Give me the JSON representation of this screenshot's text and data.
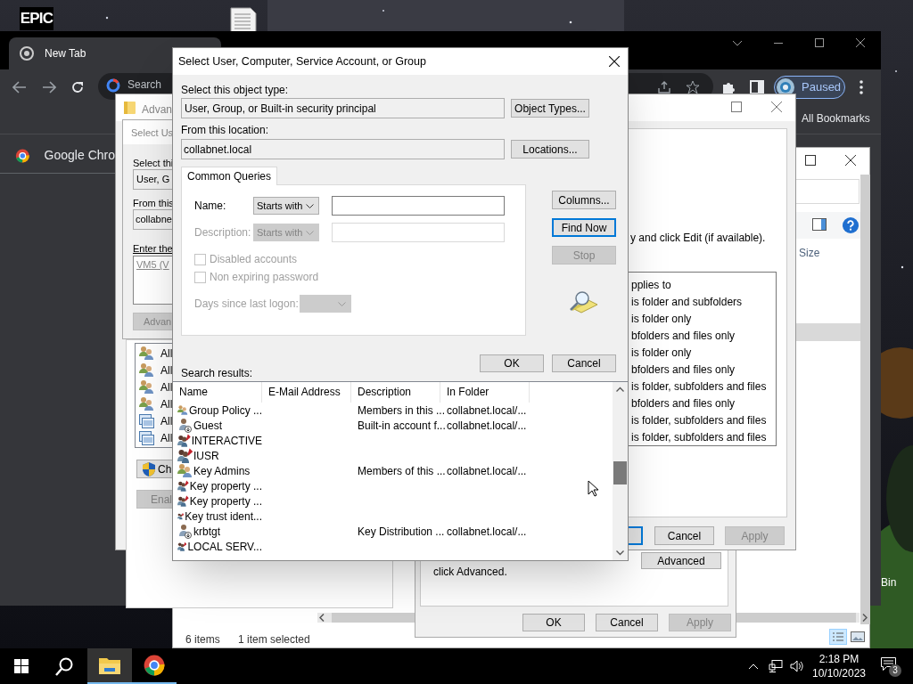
{
  "desktop": {
    "logo": "EPIC",
    "recycle_bin_label": "Bin"
  },
  "browser": {
    "tab_title": "New Tab",
    "omnibox_placeholder": "Search",
    "profile": "Paused",
    "bookmarks": "All Bookmarks",
    "suggestion": "Google Chro"
  },
  "explorer": {
    "column": "Size",
    "item_count": "6 items",
    "selection": "1 item selected"
  },
  "advanced_window": {
    "title": "Advan",
    "instruction": "y and click Edit (if available).",
    "applies_header": "pplies to",
    "applies_rows": [
      "is folder and subfolders",
      "is folder only",
      "bfolders and files only",
      "is folder only",
      "bfolders and files only",
      "is folder, subfolders and files",
      "bfolders and files only",
      "is folder, subfolders and files",
      "is folder, subfolders and files"
    ],
    "principals": [
      {
        "label": "All",
        "kind": "group"
      },
      {
        "label": "All",
        "kind": "group"
      },
      {
        "label": "All",
        "kind": "group"
      },
      {
        "label": "All",
        "kind": "group"
      },
      {
        "label": "All",
        "kind": "package"
      },
      {
        "label": "All",
        "kind": "package"
      }
    ],
    "left_buttons": [
      {
        "label": "Ch",
        "kind": "shield",
        "disabled": false
      },
      {
        "label": "Enal",
        "kind": "plain",
        "disabled": true
      }
    ],
    "footer_buttons": [
      {
        "label": "Cancel",
        "disabled": false
      },
      {
        "label": "Apply",
        "disabled": true
      }
    ]
  },
  "inner_dialog": {
    "title": "Select Us",
    "object_type_label": "Select thi",
    "object_type": "User, G",
    "location_label": "From this",
    "location": "collabne",
    "names_label": "Enter the",
    "names_value": "VM5 (V",
    "advanced_button": "Advan"
  },
  "properties_dialog": {
    "note": "click Advanced.",
    "advanced_button": "Advanced",
    "buttons": [
      {
        "label": "OK",
        "disabled": false
      },
      {
        "label": "Cancel",
        "disabled": false
      },
      {
        "label": "Apply",
        "disabled": true
      }
    ]
  },
  "main_dialog": {
    "title": "Select User, Computer, Service Account, or Group",
    "object_type_label": "Select this object type:",
    "object_type": "User, Group, or Built-in security principal",
    "object_types_button": "Object Types...",
    "location_label": "From this location:",
    "location": "collabnet.local",
    "locations_button": "Locations...",
    "tabs": [
      {
        "label": "Common Queries",
        "selected": true
      }
    ],
    "queries": [
      {
        "label": "Name:",
        "operator": "Starts with",
        "disabled": false
      },
      {
        "label": "Description:",
        "operator": "Starts with",
        "disabled": true
      }
    ],
    "checkboxes": [
      {
        "label": "Disabled accounts",
        "checked": false,
        "disabled": true
      },
      {
        "label": "Non expiring password",
        "checked": false,
        "disabled": true
      }
    ],
    "days_label": "Days since last logon:",
    "side_buttons": [
      {
        "label": "Columns...",
        "default": false,
        "disabled": false
      },
      {
        "label": "Find Now",
        "default": true,
        "disabled": false
      },
      {
        "label": "Stop",
        "default": false,
        "disabled": true
      }
    ],
    "ok": "OK",
    "cancel": "Cancel",
    "results_label": "Search results:",
    "columns": [
      "Name",
      "E-Mail Address",
      "Description",
      "In Folder"
    ],
    "results": [
      {
        "kind": "group",
        "name": "Group Policy ...",
        "description": "Members in this ...",
        "folder": "collabnet.local/..."
      },
      {
        "kind": "user",
        "name": "Guest",
        "description": "Built-in account f...",
        "folder": "collabnet.local/..."
      },
      {
        "kind": "principal",
        "name": "INTERACTIVE"
      },
      {
        "kind": "principal",
        "name": "IUSR"
      },
      {
        "kind": "group",
        "name": "Key Admins",
        "description": "Members of this ...",
        "folder": "collabnet.local/..."
      },
      {
        "kind": "principal",
        "name": "Key property ..."
      },
      {
        "kind": "principal",
        "name": "Key property ..."
      },
      {
        "kind": "principal",
        "name": "Key trust ident..."
      },
      {
        "kind": "user",
        "name": "krbtgt",
        "description": "Key Distribution ...",
        "folder": "collabnet.local/..."
      },
      {
        "kind": "principal",
        "name": "LOCAL SERV..."
      }
    ]
  },
  "taskbar": {
    "apps": [
      {
        "kind": "explorer",
        "active": true
      },
      {
        "kind": "chrome",
        "active": false
      }
    ],
    "time": "2:18 PM",
    "date": "10/10/2023",
    "notifications": "3"
  }
}
